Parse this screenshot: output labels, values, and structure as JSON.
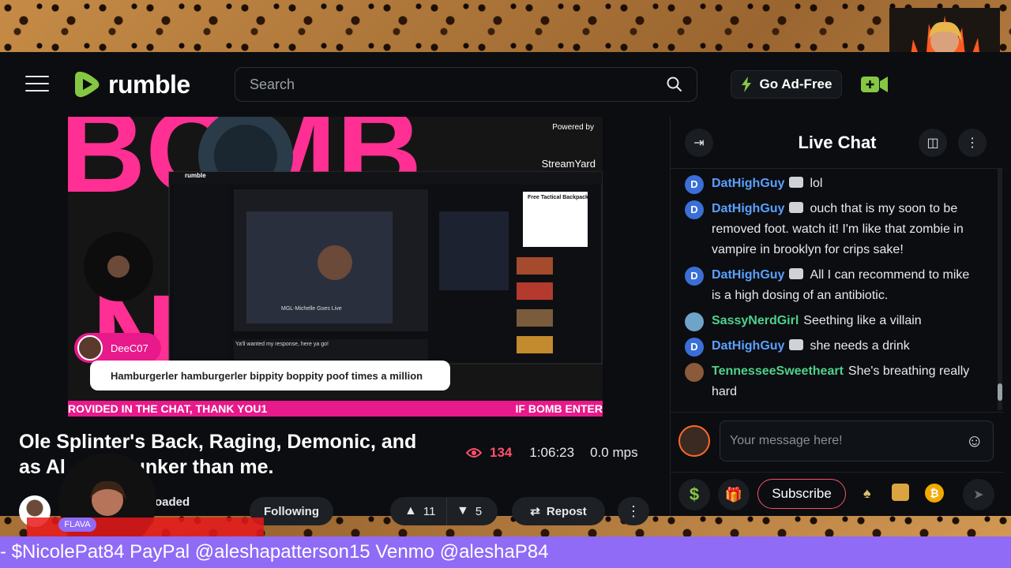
{
  "app": {
    "logo_text": "rumble",
    "brand_color": "#85c742"
  },
  "search": {
    "placeholder": "Search"
  },
  "header": {
    "ad_free_label": "Go Ad-Free"
  },
  "video": {
    "streamyard_powered": "Powered by",
    "streamyard_name": "StreamYard",
    "commenter_name": "DeeC07",
    "comment_text": "Hamburgerler hamburgerler bippity boppity poof times a million",
    "banner_left": "ROVIDED IN THE CHAT, THANK YOU1",
    "banner_right": "IF BOMB ENTER",
    "inner_title": "MGL-Michelle Goes Live",
    "inner_comment": "Ya'll wanted my response, here ya go!",
    "inner_ad_title": "Free Tactical Backpack"
  },
  "title": "Ole Splinter's Back, Raging, Demonic, and as Al... Drunker than me.",
  "title_line1": "Ole Splinter's Back, Raging, Demonic, and",
  "title_line2_a": "as Al",
  "title_line2_b": "Drunker than me.",
  "stats": {
    "views": "134",
    "duration": "1:06:23",
    "rate": "0.0 mps"
  },
  "channel": {
    "status": "oaded",
    "follow_label": "Following",
    "likes": "11",
    "dislikes": "5",
    "repost_label": "Repost"
  },
  "chat": {
    "title": "Live Chat",
    "input_placeholder": "Your message here!",
    "subscribe_label": "Subscribe",
    "messages": [
      {
        "user": "DatHighGuy",
        "initial": "D",
        "color": "#5aa0ff",
        "text": "lol"
      },
      {
        "user": "DatHighGuy",
        "initial": "D",
        "color": "#5aa0ff",
        "text": "ouch that is my soon to be removed foot. watch it! I'm like that zombie in vampire in brooklyn for crips sake!"
      },
      {
        "user": "DatHighGuy",
        "initial": "D",
        "color": "#5aa0ff",
        "text": "All I can recommend to mike is a high dosing of an antibiotic."
      },
      {
        "user": "SassyNerdGirl",
        "initial": "",
        "color": "#4fd18b",
        "text": "Seething like a villain"
      },
      {
        "user": "DatHighGuy",
        "initial": "D",
        "color": "#5aa0ff",
        "text": "she needs a drink"
      },
      {
        "user": "TennesseeSweetheart",
        "initial": "",
        "color": "#4fd18b",
        "text": "She's breathing really hard"
      }
    ]
  },
  "guest": {
    "label": "FLAVA"
  },
  "ticker": {
    "text": "- $NicolePat84 PayPal @aleshapatterson15 Venmo @aleshaP84"
  }
}
